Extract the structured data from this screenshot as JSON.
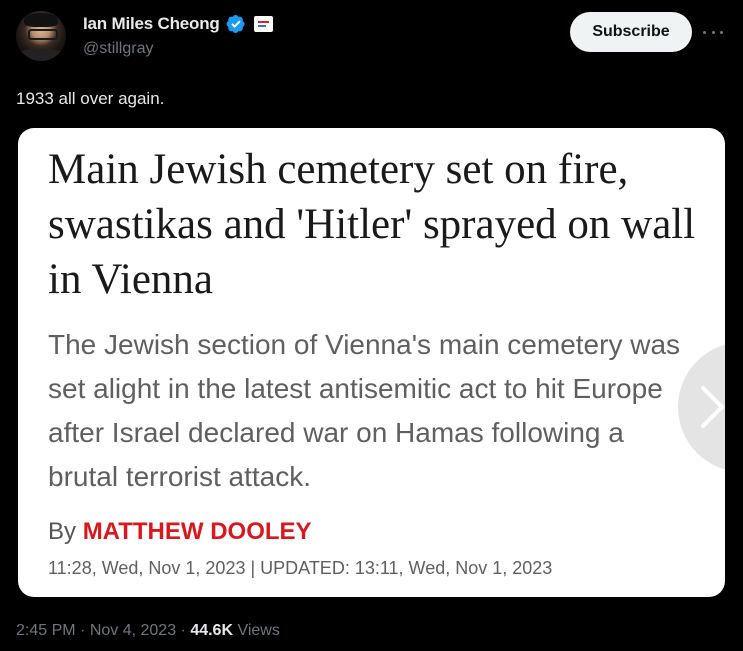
{
  "author": {
    "display_name": "Ian Miles Cheong",
    "handle": "@stillgray",
    "verified": true
  },
  "actions": {
    "subscribe_label": "Subscribe"
  },
  "tweet": {
    "text": "1933 all over again."
  },
  "article_card": {
    "headline": "Main Jewish cemetery set on fire, swastikas and 'Hitler' sprayed on wall in Vienna",
    "summary": "The Jewish section of Vienna's main cemetery was set alight in the latest antisemitic act to hit Europe after Israel declared war on Hamas following a brutal terrorist attack.",
    "byline_prefix": "By ",
    "author_name": "MATTHEW DOOLEY",
    "dateline": "11:28, Wed, Nov 1, 2023 | UPDATED: 13:11, Wed, Nov 1, 2023"
  },
  "meta": {
    "time": "2:45 PM",
    "separator": " · ",
    "date": "Nov 4, 2023",
    "views_count": "44.6K",
    "views_label": " Views"
  },
  "colors": {
    "background": "#000000",
    "verified_blue": "#1d9bf0",
    "author_red": "#d7191f"
  },
  "icons": [
    "verified-badge-icon",
    "affiliate-badge-icon",
    "more-options-icon",
    "chevron-right-icon"
  ]
}
